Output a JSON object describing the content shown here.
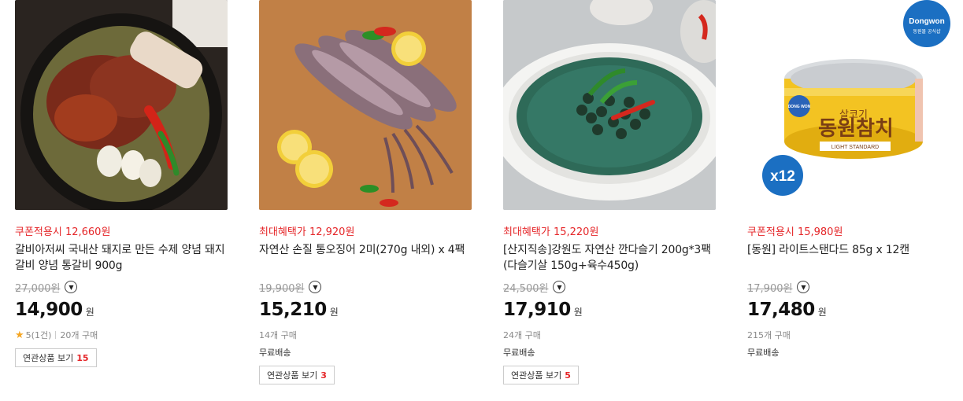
{
  "products": [
    {
      "promo_label": "쿠폰적용시",
      "promo_price": "12,660원",
      "title": "갈비아저씨 국내산 돼지로 만든 수제 양념 돼지갈비 양념 통갈비 900g",
      "original_price": "27,000원",
      "price": "14,900",
      "currency": "원",
      "rating": "5(1건)",
      "purchases": "20개 구매",
      "shipping": "",
      "related_label": "연관상품 보기",
      "related_count": "15"
    },
    {
      "promo_label": "최대혜택가",
      "promo_price": "12,920원",
      "title": "자연산 손질 통오징어 2미(270g 내외) x 4팩",
      "original_price": "19,900원",
      "price": "15,210",
      "currency": "원",
      "purchases": "14개 구매",
      "shipping": "무료배송",
      "related_label": "연관상품 보기",
      "related_count": "3"
    },
    {
      "promo_label": "최대혜택가",
      "promo_price": "15,220원",
      "title": "[산지직송]강원도 자연산 깐다슬기 200g*3팩 (다슬기살 150g+육수450g)",
      "original_price": "24,500원",
      "price": "17,910",
      "currency": "원",
      "purchases": "24개 구매",
      "shipping": "무료배송",
      "related_label": "연관상품 보기",
      "related_count": "5"
    },
    {
      "promo_label": "쿠폰적용시",
      "promo_price": "15,980원",
      "title": "[동원] 라이트스탠다드 85g x 12캔",
      "original_price": "17,900원",
      "price": "17,480",
      "currency": "원",
      "purchases": "215개 구매",
      "shipping": "무료배송",
      "badge_qty": "x12",
      "brand_badge": "Dongwon",
      "brand_badge_sub": "동원몰 공식샵",
      "can_text_top": "살코기",
      "can_text_main": "동원참치",
      "can_text_sub": "LIGHT STANDARD",
      "can_logo": "DONG WON"
    }
  ],
  "colors": {
    "accent": "#e52528",
    "star": "#f5a623",
    "badge": "#1b6fc2"
  }
}
